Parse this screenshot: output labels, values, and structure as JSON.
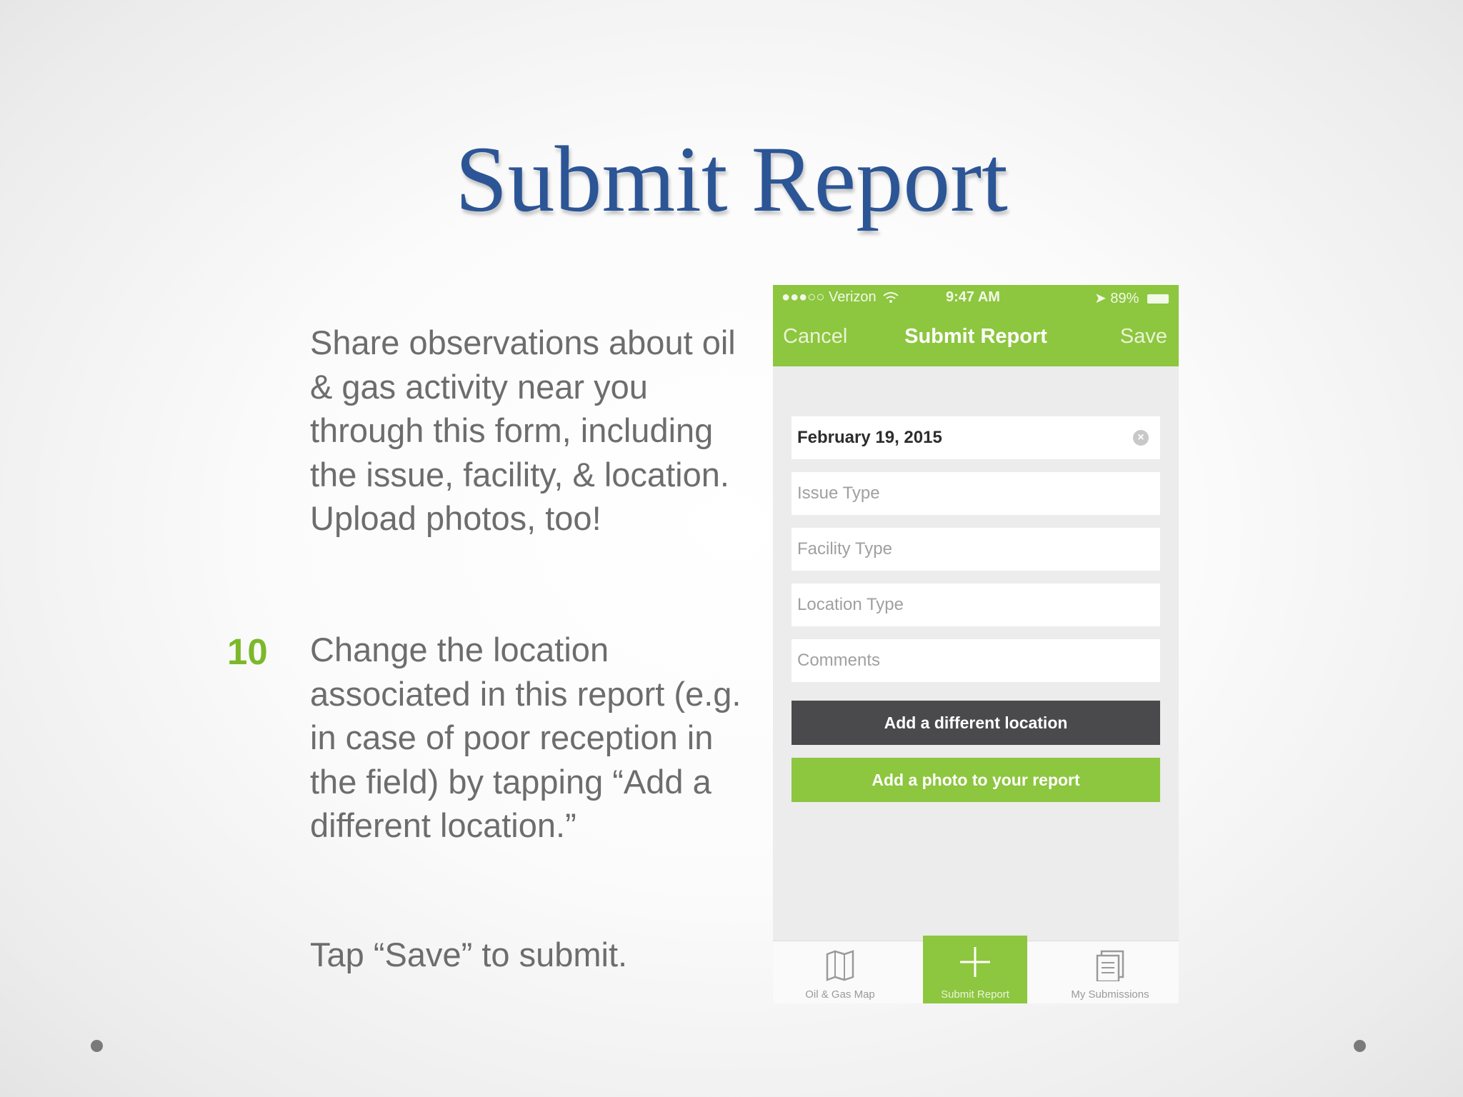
{
  "slide": {
    "title": "Submit Report",
    "paragraph1": "Share observations about oil & gas activity near you through this form, including the issue, facility, & location. Upload photos, too!",
    "step_number": "10",
    "paragraph2": "Change the location associated in this report (e.g. in case of poor reception in the field) by tapping “Add a different location.”",
    "paragraph3": "Tap “Save” to submit."
  },
  "phone": {
    "status": {
      "carrier": "●●●○○ Verizon",
      "time": "9:47 AM",
      "battery": "89%"
    },
    "nav": {
      "cancel": "Cancel",
      "title": "Submit Report",
      "save": "Save"
    },
    "form": {
      "date_value": "February 19, 2015",
      "issue_placeholder": "Issue Type",
      "facility_placeholder": "Facility Type",
      "location_placeholder": "Location Type",
      "comments_placeholder": "Comments",
      "add_location_label": "Add a different location",
      "add_photo_label": "Add a photo to your report"
    },
    "tabs": [
      {
        "label": "Oil & Gas Map",
        "icon": "map-icon"
      },
      {
        "label": "Submit Report",
        "icon": "plus-icon"
      },
      {
        "label": "My Submissions",
        "icon": "documents-icon"
      }
    ],
    "colors": {
      "accent": "#8dc63f",
      "dark_button": "#4a4a4d",
      "title_blue": "#2c5596"
    }
  }
}
